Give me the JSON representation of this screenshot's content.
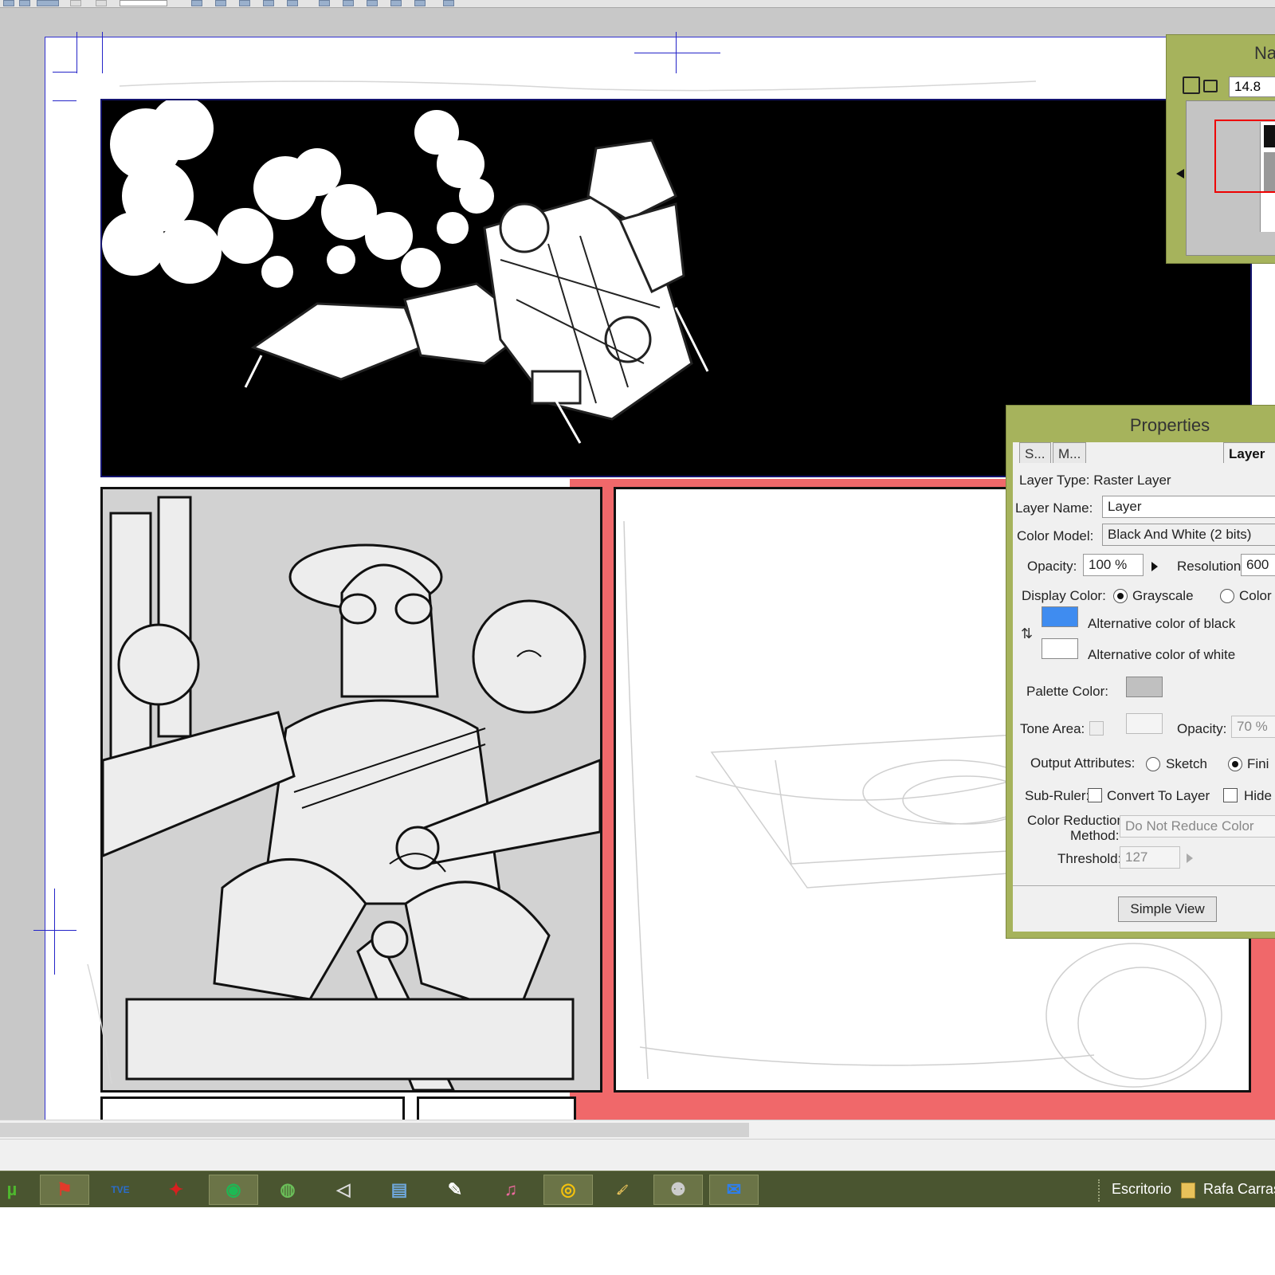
{
  "navigator": {
    "title": "Na",
    "zoom": "14.8",
    "frame_color": "#e00000"
  },
  "properties": {
    "title": "Properties",
    "tabs": [
      {
        "label": "S..."
      },
      {
        "label": "M..."
      },
      {
        "label": "Layer"
      }
    ],
    "layer_type": "Layer Type: Raster Layer",
    "layer_name_label": "Layer Name:",
    "layer_name_value": "Layer",
    "color_model_label": "Color Model:",
    "color_model_value": "Black And White (2 bits)",
    "opacity_label": "Opacity:",
    "opacity_value": "100 %",
    "resolution_label": "Resolution:",
    "resolution_value": "600",
    "display_color_label": "Display Color:",
    "display_color_options": [
      {
        "label": "Grayscale",
        "selected": true
      },
      {
        "label": "Color",
        "selected": false
      }
    ],
    "alt_black_label": "Alternative color of black",
    "alt_black_color": "#3f8cf0",
    "alt_white_label": "Alternative color of white",
    "alt_white_color": "#ffffff",
    "palette_color_label": "Palette Color:",
    "palette_color": "#c0c0c0",
    "tone_area_label": "Tone Area:",
    "tone_opacity_label": "Opacity:",
    "tone_opacity_value": "70 %",
    "output_attributes_label": "Output Attributes:",
    "output_options": [
      {
        "label": "Sketch",
        "selected": false
      },
      {
        "label": "Fini",
        "selected": true
      }
    ],
    "sub_ruler_label": "Sub-Ruler:",
    "convert_to_layer_label": "Convert To Layer",
    "hide_label": "Hide",
    "color_reduction_label_1": "Color Reduction",
    "color_reduction_label_2": "Method:",
    "color_reduction_value": "Do Not Reduce Color",
    "threshold_label": "Threshold:",
    "threshold_value": "127",
    "simple_view_label": "Simple View",
    "panel_color": "#a6b35c"
  },
  "canvas": {
    "page_color": "#ffffff",
    "bleed_color": "#f0686a",
    "guide_color": "#2424c8"
  },
  "taskbar": {
    "icons": [
      {
        "name": "utorrent-icon",
        "glyph": "µ"
      },
      {
        "name": "app-red-icon",
        "glyph": "⚑"
      },
      {
        "name": "tve-icon",
        "glyph": "TVE"
      },
      {
        "name": "acrobat-icon",
        "glyph": "✦"
      },
      {
        "name": "spotify-icon",
        "glyph": "◉"
      },
      {
        "name": "globe-app-icon",
        "glyph": "◍"
      },
      {
        "name": "unity-icon",
        "glyph": "◁"
      },
      {
        "name": "files-icon",
        "glyph": "▤"
      },
      {
        "name": "drawing-app-icon",
        "glyph": "✎"
      },
      {
        "name": "itunes-icon",
        "glyph": "♫"
      },
      {
        "name": "chrome-icon",
        "glyph": "◎"
      },
      {
        "name": "paint-icon",
        "glyph": "🖌"
      },
      {
        "name": "comic-studio-icon",
        "glyph": "⚉"
      },
      {
        "name": "mail-icon",
        "glyph": "✉"
      }
    ],
    "desktop_label": "Escritorio",
    "user_label": "Rafa Carras",
    "color": "#4a5530"
  }
}
